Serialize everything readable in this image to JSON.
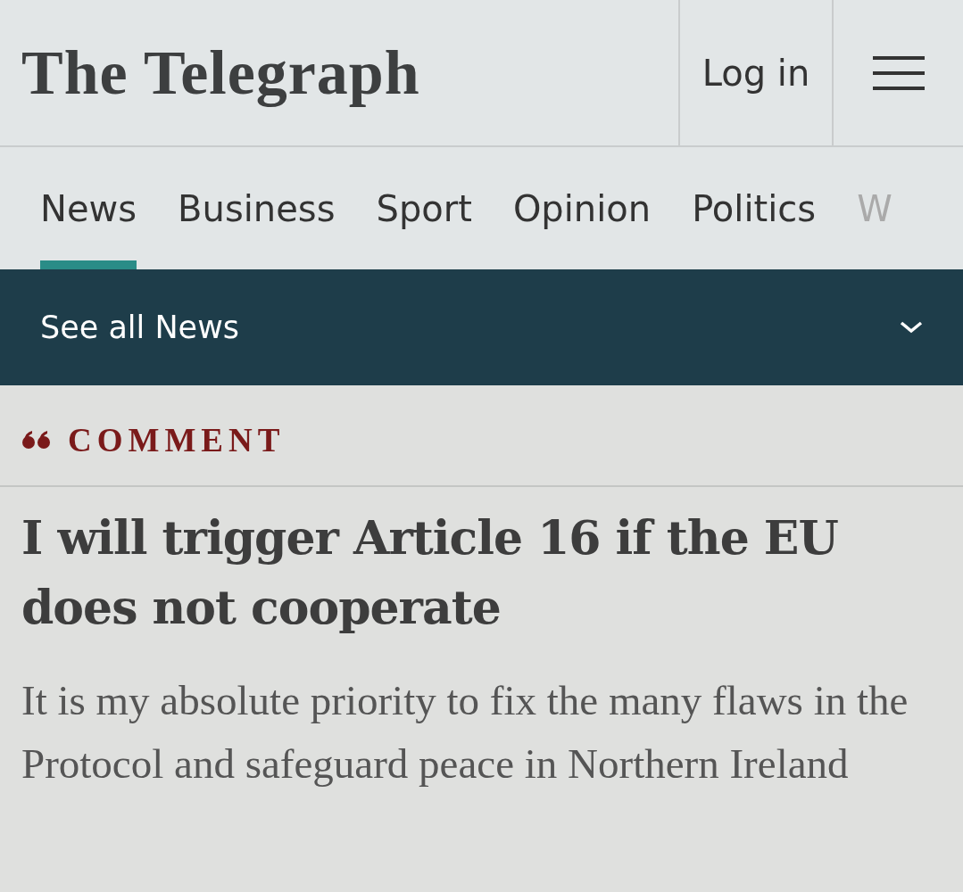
{
  "header": {
    "logo": "The Telegraph",
    "login": "Log in"
  },
  "tabs": [
    {
      "label": "News",
      "selected": true
    },
    {
      "label": "Business",
      "selected": false
    },
    {
      "label": "Sport",
      "selected": false
    },
    {
      "label": "Opinion",
      "selected": false
    },
    {
      "label": "Politics",
      "selected": false
    },
    {
      "label": "W",
      "selected": false
    }
  ],
  "subnav": {
    "label": "See all News"
  },
  "article": {
    "section": "COMMENT",
    "headline": "I will trigger Article 16 if the EU does not cooperate",
    "standfirst": "It is my absolute priority to fix the many flaws in the Protocol and safeguard peace in Northern Ireland"
  }
}
